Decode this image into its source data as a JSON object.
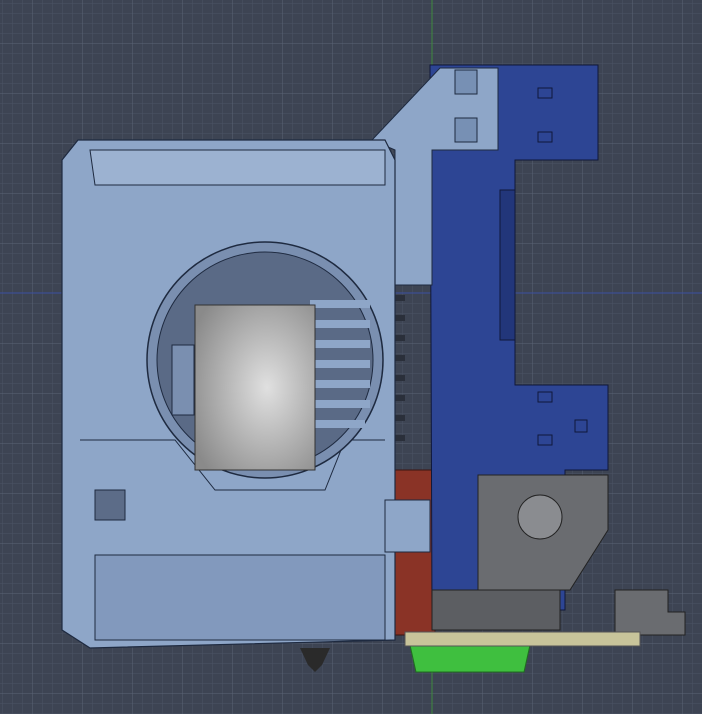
{
  "viewport": {
    "background": "#3d4453",
    "grid_minor": "#4a5262",
    "grid_major": "#566072",
    "axis_y_color": "#3f8a3f",
    "axis_x_color": "#3c4fa0"
  },
  "parts": {
    "shroud_color": "#8ea6c8",
    "shroud_shade": "#7790b4",
    "carriage_color": "#2d4594",
    "carriage_shade": "#22367a",
    "motor_color": "#b8b8b8",
    "heater_color": "#8a3326",
    "pcb_color": "#c8c49a",
    "nozzle_sock_color": "#3fbf3f",
    "bracket_color": "#666a70"
  }
}
